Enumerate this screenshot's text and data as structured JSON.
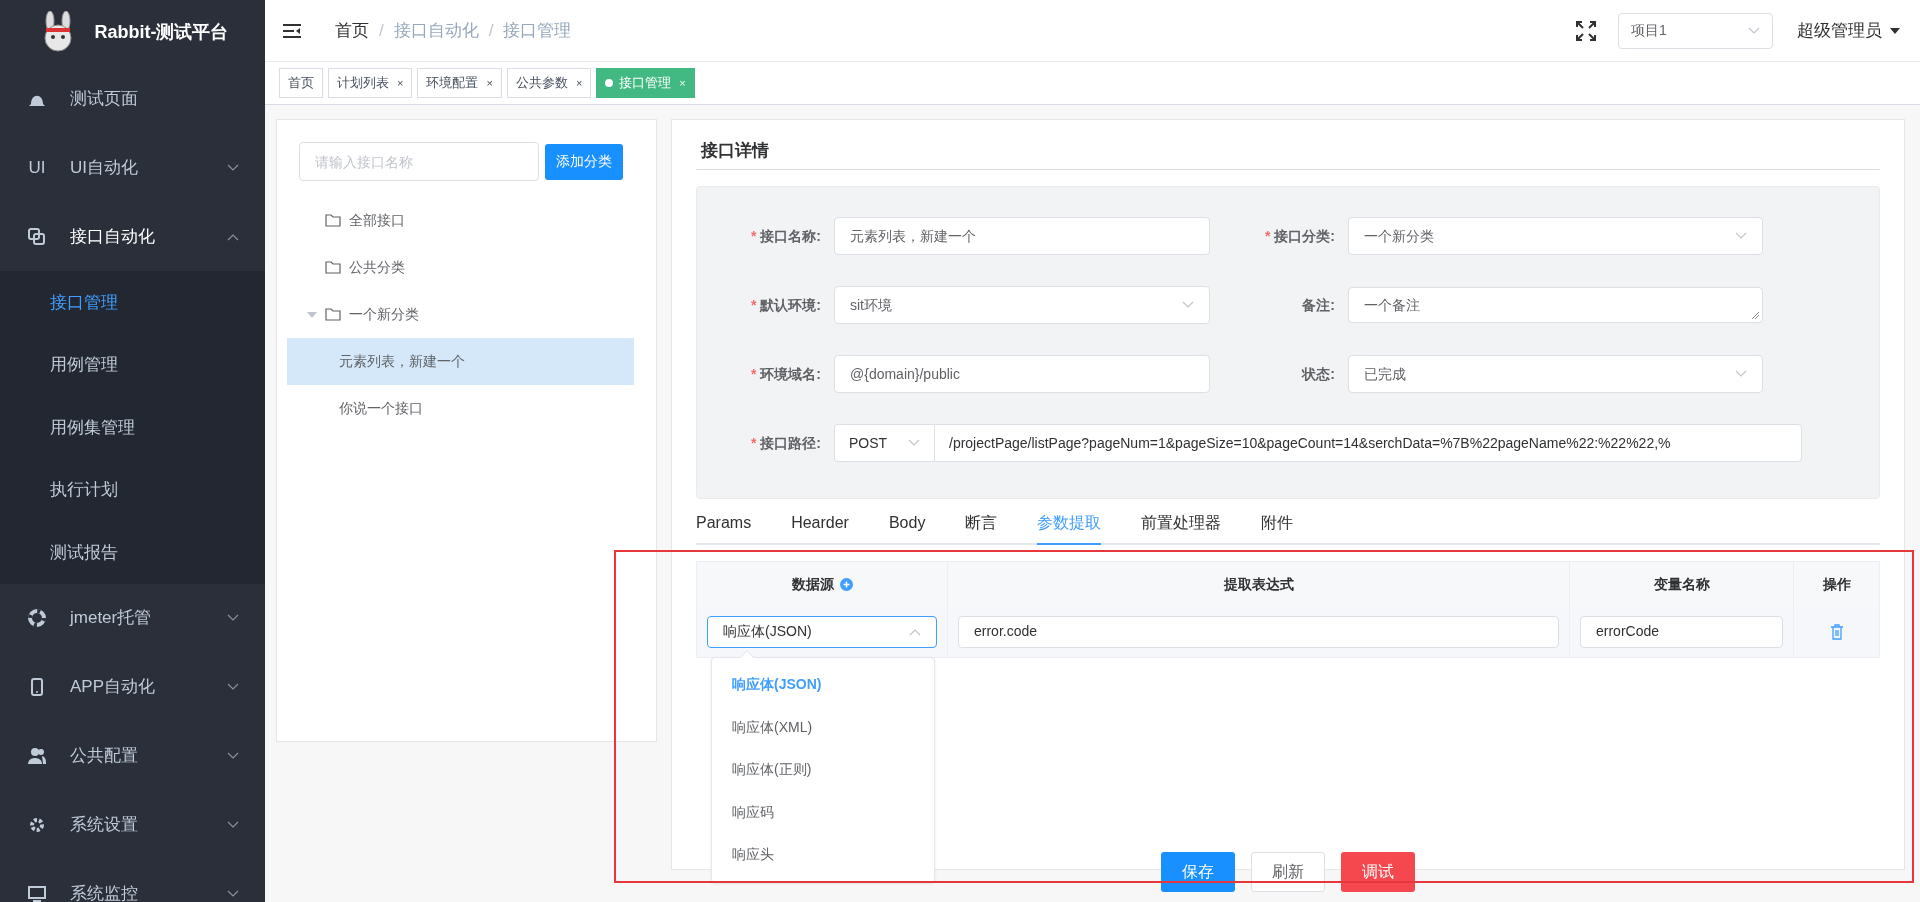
{
  "sidebar": {
    "logo_text": "Rabbit-测试平台",
    "items": [
      {
        "kind": "item",
        "label": "测试页面",
        "selected": false
      },
      {
        "kind": "group",
        "icon_text": "UI",
        "label": "UI自动化",
        "expanded": false,
        "selected": false
      },
      {
        "kind": "group",
        "label": "接口自动化",
        "expanded": true,
        "selected": true,
        "children": [
          {
            "label": "接口管理",
            "selected": true
          },
          {
            "label": "用例管理",
            "selected": false
          },
          {
            "label": "用例集管理",
            "selected": false
          },
          {
            "label": "执行计划",
            "selected": false
          },
          {
            "label": "测试报告",
            "selected": false
          }
        ]
      },
      {
        "kind": "group",
        "label": "jmeter托管",
        "expanded": false,
        "selected": false
      },
      {
        "kind": "group",
        "label": "APP自动化",
        "expanded": false,
        "selected": false
      },
      {
        "kind": "group",
        "label": "公共配置",
        "expanded": false,
        "selected": false
      },
      {
        "kind": "group",
        "label": "系统设置",
        "expanded": false,
        "selected": false
      },
      {
        "kind": "group",
        "label": "系统监控",
        "expanded": false,
        "selected": false
      }
    ]
  },
  "header": {
    "breadcrumb": [
      "首页",
      "接口自动化",
      "接口管理"
    ],
    "separator": "/",
    "project": "项目1",
    "user": "超级管理员"
  },
  "tags": [
    {
      "label": "首页",
      "selected": false
    },
    {
      "label": "计划列表",
      "close": "×",
      "selected": false
    },
    {
      "label": "环境配置",
      "close": "×",
      "selected": false
    },
    {
      "label": "公共参数",
      "close": "×",
      "selected": false
    },
    {
      "label": "接口管理",
      "close": "×",
      "selected": true
    }
  ],
  "tree": {
    "search_placeholder": "请输入接口名称",
    "add_button": "添加分类",
    "nodes": [
      {
        "label": "全部接口",
        "selected": false
      },
      {
        "label": "公共分类",
        "selected": false
      },
      {
        "label": "一个新分类",
        "selected": false,
        "expanded": true,
        "children": [
          {
            "label": "元素列表，新建一个",
            "selected": true
          },
          {
            "label": "你说一个接口",
            "selected": false
          }
        ]
      }
    ]
  },
  "detail": {
    "title": "接口详情",
    "required_mark": "*",
    "fields": [
      {
        "kind": "input",
        "label": "接口名称:",
        "required": true,
        "value": "元素列表，新建一个"
      },
      {
        "kind": "select",
        "label": "接口分类:",
        "required": true,
        "value": "一个新分类"
      },
      {
        "kind": "select",
        "label": "默认环境:",
        "required": true,
        "value": "sit环境"
      },
      {
        "kind": "textarea",
        "label": "备注:",
        "required": false,
        "value": "一个备注"
      },
      {
        "kind": "input",
        "label": "环境域名:",
        "required": true,
        "value": "@{domain}/public"
      },
      {
        "kind": "select",
        "label": "状态:",
        "required": false,
        "value": "已完成"
      },
      {
        "kind": "path",
        "label": "接口路径:",
        "required": true,
        "method": "POST",
        "value": "/projectPage/listPage?pageNum=1&pageSize=10&pageCount=14&serchData=%7B%22pageName%22:%22%22,%"
      }
    ],
    "tabs": [
      {
        "label": "Params",
        "selected": false
      },
      {
        "label": "Hearder",
        "selected": false
      },
      {
        "label": "Body",
        "selected": false
      },
      {
        "label": "断言",
        "selected": false
      },
      {
        "label": "参数提取",
        "selected": true
      },
      {
        "label": "前置处理器",
        "selected": false
      },
      {
        "label": "附件",
        "selected": false
      }
    ],
    "table": {
      "columns": [
        "数据源",
        "提取表达式",
        "变量名称",
        "操作"
      ],
      "rows": [
        {
          "source": "响应体(JSON)",
          "expression": "error.code",
          "variable": "errorCode"
        }
      ]
    },
    "source_dropdown": {
      "expanded": true,
      "options": [
        {
          "label": "响应体(JSON)",
          "selected": true
        },
        {
          "label": "响应体(XML)",
          "selected": false
        },
        {
          "label": "响应体(正则)",
          "selected": false
        },
        {
          "label": "响应码",
          "selected": false
        },
        {
          "label": "响应头",
          "selected": false
        }
      ]
    },
    "buttons": [
      {
        "kind": "primary",
        "label": "保存"
      },
      {
        "kind": "default",
        "label": "刷新"
      },
      {
        "kind": "danger",
        "label": "调试"
      }
    ]
  }
}
